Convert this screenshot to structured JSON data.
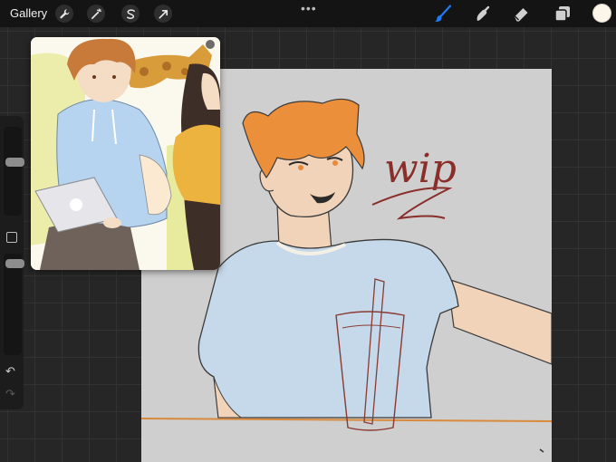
{
  "topbar": {
    "gallery_label": "Gallery",
    "left_tools": [
      "wrench-icon",
      "magic-wand-icon",
      "selection-icon",
      "transform-arrow-icon"
    ],
    "more_label": "•••",
    "right_tools": [
      "brush-icon",
      "smudge-icon",
      "eraser-icon",
      "layers-icon"
    ],
    "active_tool": "brush-icon",
    "active_color": "#fbf5ea",
    "accent": "#1f7cf2"
  },
  "sidebar": {
    "controls": [
      "brush-size-slider",
      "modify-button",
      "opacity-slider",
      "undo-button",
      "redo-button"
    ],
    "undo_glyph": "↶",
    "redo_glyph": "↷"
  },
  "canvas": {
    "handwritten_text": "wip",
    "background": "#cfcfcf"
  },
  "reference": {
    "subject": "two illustrated characters on a yellow couch, one with a laptop",
    "background": "#fbf8ee"
  }
}
